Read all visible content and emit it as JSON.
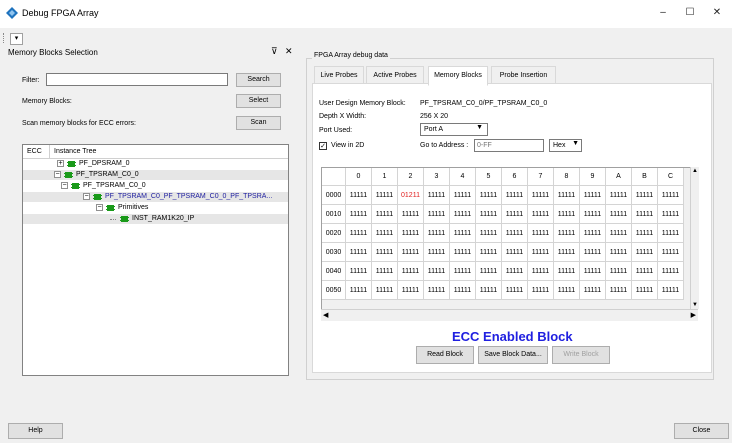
{
  "window": {
    "title": "Debug FPGA Array",
    "minimize": "–",
    "maximize": "☐",
    "close": "✕"
  },
  "toolstrip": {
    "glyph": "▾"
  },
  "left_panel": {
    "title": "Memory Blocks Selection",
    "pin": "⊽",
    "close": "✕",
    "filter_label": "Filter:",
    "filter_value": "",
    "search_label": "Search",
    "memory_blocks_label": "Memory Blocks:",
    "select_label": "Select",
    "scan_text": "Scan memory blocks for ECC errors:",
    "scan_label": "Scan",
    "tree": {
      "col_ecc": "ECC",
      "col_instance": "Instance Tree",
      "rows": [
        {
          "label": "PF_DPSRAM_0",
          "expander": "⊞",
          "highlight": false,
          "bold": false
        },
        {
          "label": "PF_TPSRAM_C0_0",
          "expander": "⊟",
          "highlight": true,
          "bold": false
        },
        {
          "label": "PF_TPSRAM_C0_0",
          "expander": "⊟",
          "highlight": false,
          "bold": false
        },
        {
          "label": "PF_TPSRAM_C0_PF_TPSRAM_C0_0_PF_TPSRA...",
          "expander": "⊟",
          "highlight": true,
          "bold": false
        },
        {
          "label": "Primitives",
          "expander": "⊟",
          "highlight": false,
          "bold": false
        },
        {
          "label": "INST_RAM1K20_IP",
          "expander": "",
          "highlight": true,
          "bold": false
        }
      ]
    }
  },
  "right_panel": {
    "group_title": "FPGA Array debug data",
    "tabs": [
      {
        "label": "Live Probes",
        "active": false
      },
      {
        "label": "Active Probes",
        "active": false
      },
      {
        "label": "Memory Blocks",
        "active": true
      },
      {
        "label": "Probe Insertion",
        "active": false
      }
    ],
    "user_design_label": "User Design Memory Block:",
    "user_design_value": "PF_TPSRAM_C0_0/PF_TPSRAM_C0_0",
    "depth_label": "Depth X Width:",
    "depth_value": "256 X 20",
    "port_label": "Port Used:",
    "port_value": "Port A",
    "view2d_label": "View in 2D",
    "view2d_checked": "✓",
    "goto_label": "Go to Address :",
    "goto_placeholder": "0-FF",
    "format_value": "Hex",
    "grid": {
      "columns": [
        "0",
        "1",
        "2",
        "3",
        "4",
        "5",
        "6",
        "7",
        "8",
        "9",
        "A",
        "B",
        "C"
      ],
      "rows": [
        {
          "addr": "0000",
          "cells": [
            "11111",
            "11111",
            "01211",
            "11111",
            "11111",
            "11111",
            "11111",
            "11111",
            "11111",
            "11111",
            "11111",
            "11111",
            "11111"
          ]
        },
        {
          "addr": "0010",
          "cells": [
            "11111",
            "11111",
            "11111",
            "11111",
            "11111",
            "11111",
            "11111",
            "11111",
            "11111",
            "11111",
            "11111",
            "11111",
            "11111"
          ]
        },
        {
          "addr": "0020",
          "cells": [
            "11111",
            "11111",
            "11111",
            "11111",
            "11111",
            "11111",
            "11111",
            "11111",
            "11111",
            "11111",
            "11111",
            "11111",
            "11111"
          ]
        },
        {
          "addr": "0030",
          "cells": [
            "11111",
            "11111",
            "11111",
            "11111",
            "11111",
            "11111",
            "11111",
            "11111",
            "11111",
            "11111",
            "11111",
            "11111",
            "11111"
          ]
        },
        {
          "addr": "0040",
          "cells": [
            "11111",
            "11111",
            "11111",
            "11111",
            "11111",
            "11111",
            "11111",
            "11111",
            "11111",
            "11111",
            "11111",
            "11111",
            "11111"
          ]
        },
        {
          "addr": "0050",
          "cells": [
            "11111",
            "11111",
            "11111",
            "11111",
            "11111",
            "11111",
            "11111",
            "11111",
            "11111",
            "11111",
            "11111",
            "11111",
            "11111"
          ]
        }
      ],
      "highlight_color": "#e02020"
    },
    "ecc_banner": "ECC Enabled Block",
    "ecc_color": "#2020e0",
    "read_block": "Read Block",
    "save_block": "Save Block Data...",
    "write_block": "Write Block"
  },
  "footer": {
    "help": "Help",
    "close": "Close"
  }
}
